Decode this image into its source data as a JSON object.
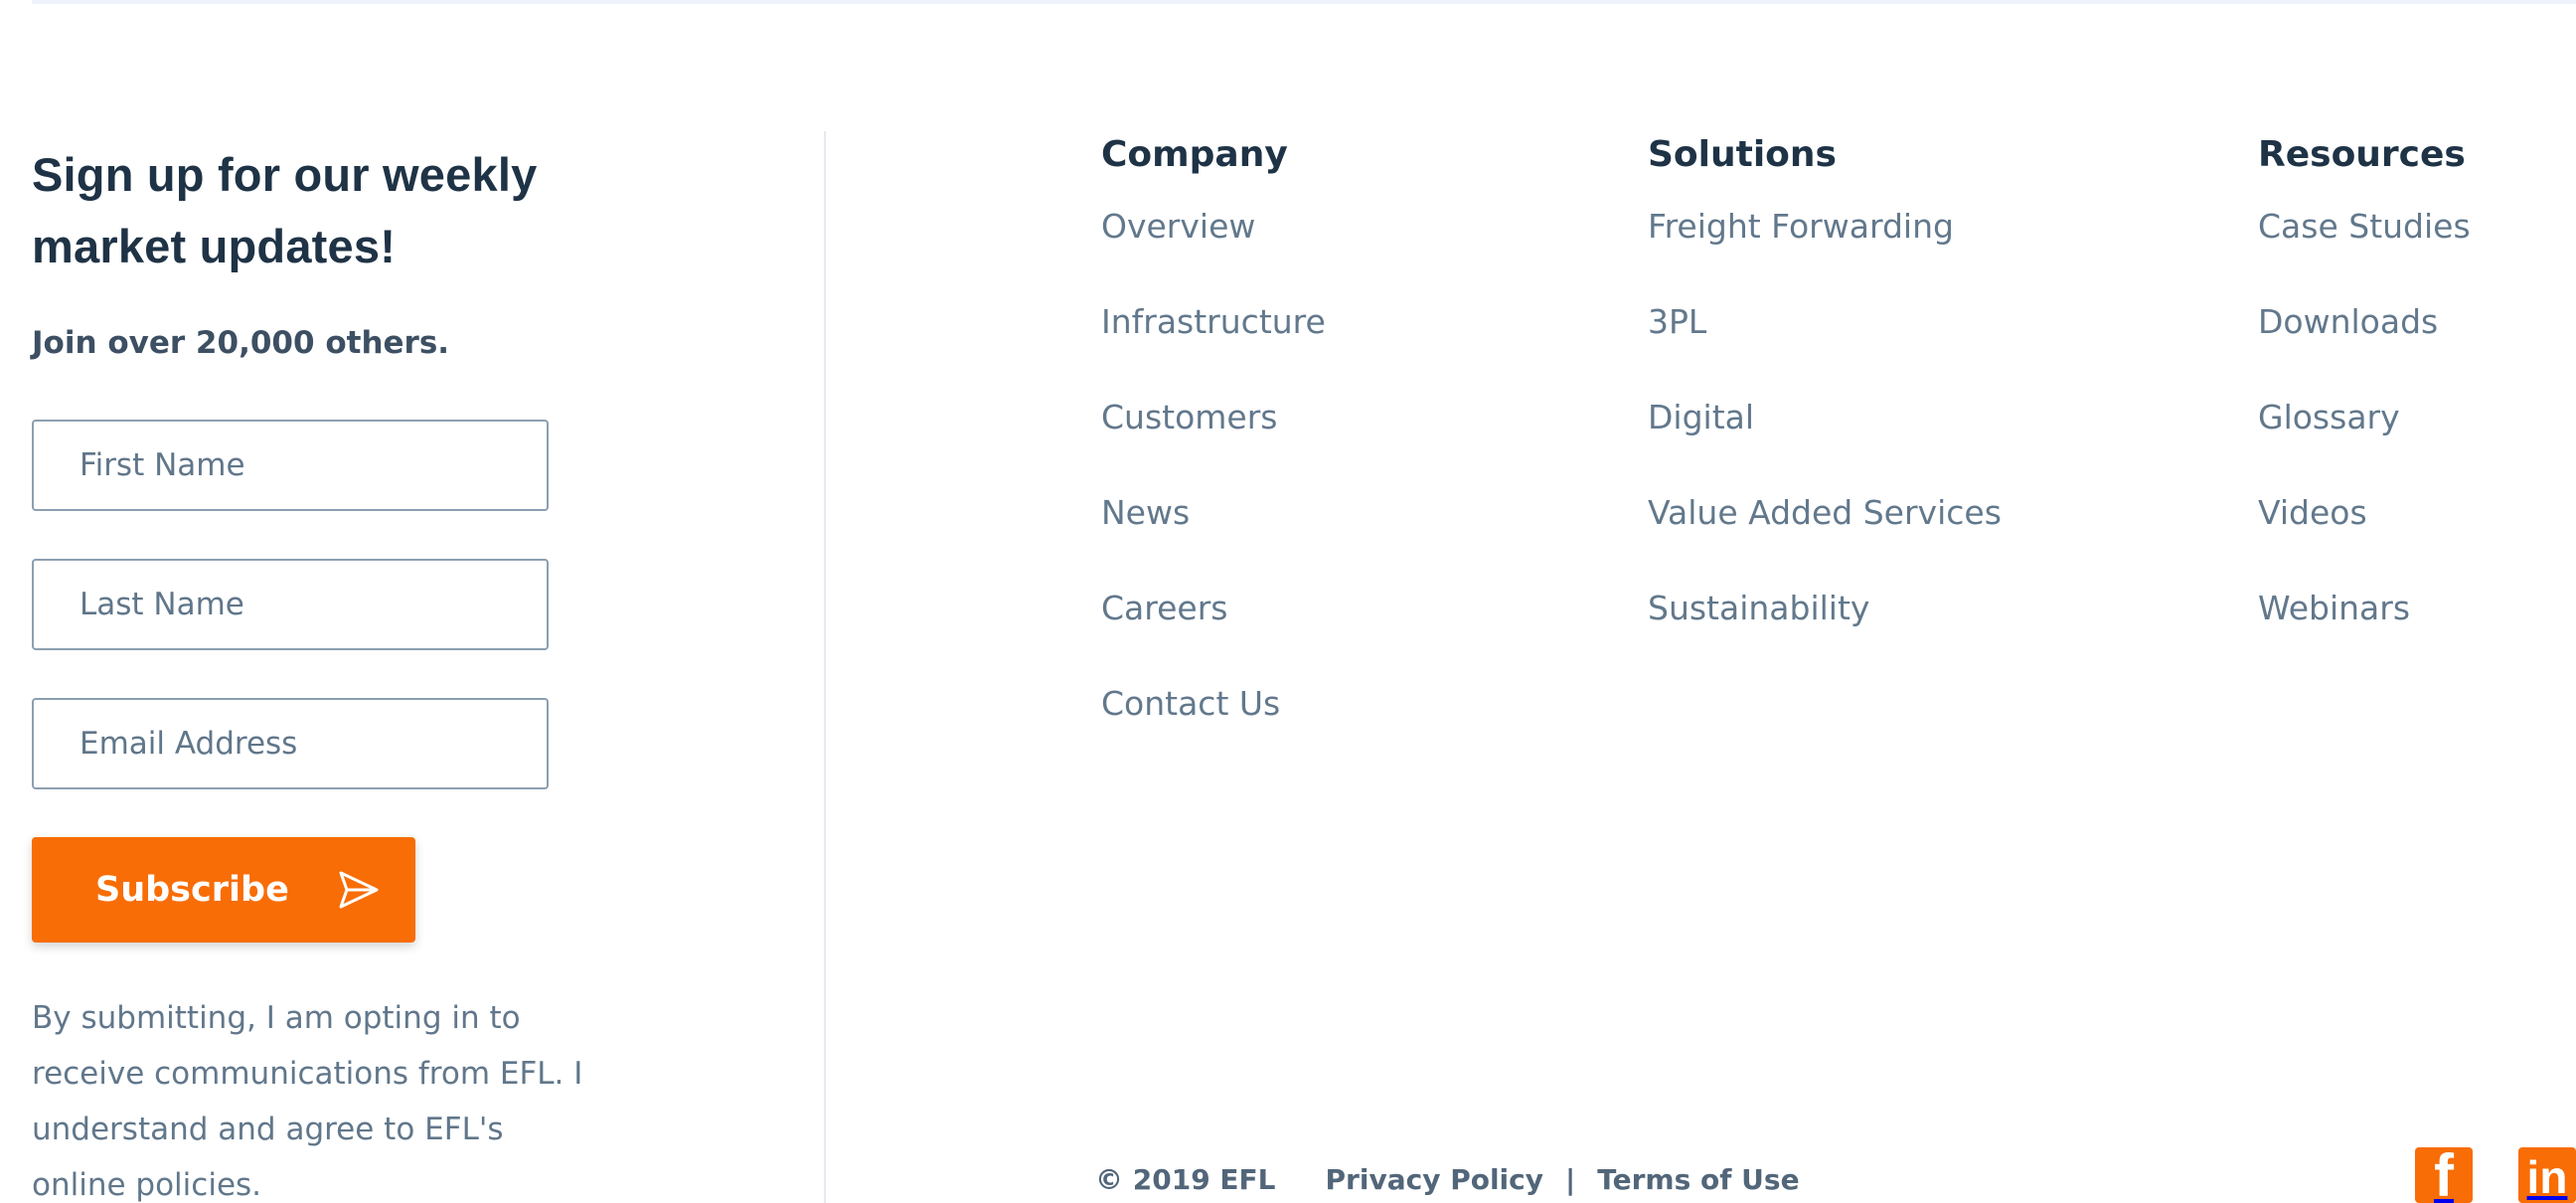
{
  "signup": {
    "title": "Sign up for our weekly market updates!",
    "subtitle": "Join over 20,000 others.",
    "first_name_placeholder": "First Name",
    "last_name_placeholder": "Last Name",
    "email_placeholder": "Email Address",
    "subscribe_label": "Subscribe",
    "consent_text": "By submitting, I am opting in to receive communications from EFL. I understand and agree to EFL's online policies."
  },
  "columns": {
    "company": {
      "heading": "Company",
      "links": [
        "Overview",
        "Infrastructure",
        "Customers",
        "News",
        "Careers",
        "Contact Us"
      ]
    },
    "solutions": {
      "heading": "Solutions",
      "links": [
        "Freight Forwarding",
        "3PL",
        "Digital",
        "Value Added Services",
        "Sustainability"
      ]
    },
    "resources": {
      "heading": "Resources",
      "links": [
        "Case Studies",
        "Downloads",
        "Glossary",
        "Videos",
        "Webinars"
      ]
    }
  },
  "footer": {
    "copyright": "© 2019 EFL",
    "privacy_label": "Privacy Policy",
    "separator": "|",
    "terms_label": "Terms of Use"
  },
  "social": {
    "facebook_glyph": "f",
    "linkedin_glyph": "in"
  },
  "colors": {
    "accent": "#f86d06",
    "heading": "#1f3346",
    "link": "#62788c",
    "border": "#8c9fb0"
  },
  "icons": {
    "subscribe": "send-icon",
    "facebook": "facebook-icon",
    "linkedin": "linkedin-icon"
  }
}
